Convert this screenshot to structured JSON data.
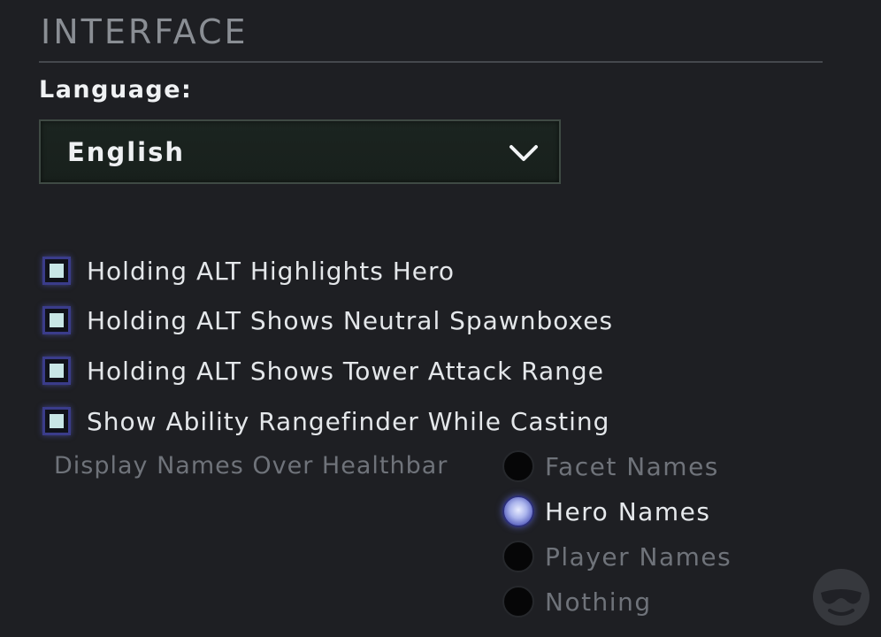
{
  "section": {
    "title": "INTERFACE"
  },
  "language": {
    "label": "Language:",
    "selected": "English"
  },
  "checkboxes": [
    {
      "label": "Holding ALT Highlights Hero",
      "checked": true
    },
    {
      "label": "Holding ALT Shows Neutral Spawnboxes",
      "checked": true
    },
    {
      "label": "Holding ALT Shows Tower Attack Range",
      "checked": true
    },
    {
      "label": "Show Ability Rangefinder While Casting",
      "checked": true
    }
  ],
  "display_names": {
    "label": "Display Names Over Healthbar",
    "options": [
      {
        "label": "Facet Names",
        "selected": false
      },
      {
        "label": "Hero Names",
        "selected": true
      },
      {
        "label": "Player Names",
        "selected": false
      },
      {
        "label": "Nothing",
        "selected": false
      }
    ]
  },
  "icons": {
    "dropdown": "chevron-down-icon",
    "watermark": "sunglasses-logo-icon"
  },
  "colors": {
    "background": "#1e1f23",
    "checkbox_fill": "#c8e6e6",
    "accent_glow": "#5a5fdc"
  }
}
